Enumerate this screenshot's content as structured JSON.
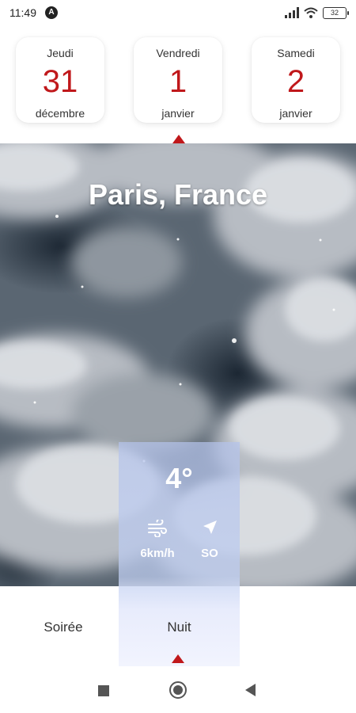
{
  "status_bar": {
    "time": "11:49",
    "app_icon_glyph": "A",
    "battery": "32",
    "icons": [
      "signal-icon",
      "wifi-icon",
      "battery-icon"
    ]
  },
  "days": [
    {
      "weekday": "Jeudi",
      "day": "31",
      "month": "décembre",
      "selected": false
    },
    {
      "weekday": "Vendredi",
      "day": "1",
      "month": "janvier",
      "selected": true
    },
    {
      "weekday": "Samedi",
      "day": "2",
      "month": "janvier",
      "selected": false
    }
  ],
  "location": {
    "city": "Paris, France"
  },
  "forecast": {
    "temperature": "4°",
    "wind_speed": "6km/h",
    "wind_direction": "SO"
  },
  "periods": [
    {
      "label": "Soirée",
      "selected": false
    },
    {
      "label": "Nuit",
      "selected": true
    }
  ],
  "colors": {
    "accent": "#c0181b",
    "highlight": "#b4c3eb",
    "text": "#333333"
  },
  "nav": {
    "icons": [
      "square-icon",
      "circle-home-icon",
      "triangle-back-icon"
    ]
  }
}
